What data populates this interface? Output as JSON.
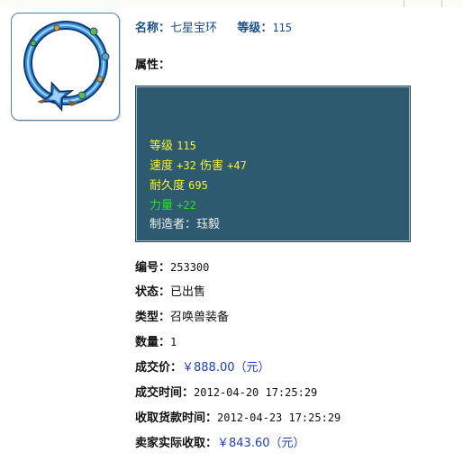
{
  "item": {
    "name_label": "名称：",
    "name": "七星宝环",
    "level_label": "等级：",
    "level": "115"
  },
  "attributes": {
    "label": "属性：",
    "lines": [
      {
        "label": "等级",
        "value": "115",
        "color": "#f7f432"
      },
      {
        "label": "速度",
        "value": "+32",
        "label2": "伤害",
        "value2": "+47",
        "color": "#f7f432"
      },
      {
        "label": "耐久度",
        "value": "695",
        "color": "#f7f432"
      },
      {
        "label": "力量",
        "value": "+22",
        "color": "#28e028"
      },
      {
        "label": "制造者：",
        "value": "珏毅",
        "color": "#f2f2f2"
      }
    ]
  },
  "details": {
    "number_label": "编号：",
    "number": "253300",
    "status_label": "状态：",
    "status": "已出售",
    "type_label": "类型：",
    "type": "召唤兽装备",
    "quantity_label": "数量：",
    "quantity": "1",
    "price_label": "成交价：",
    "price": "￥888.00（元）",
    "deal_time_label": "成交时间：",
    "deal_time": "2012-04-20 17:25:29",
    "payment_time_label": "收取货款时间：",
    "payment_time": "2012-04-23 17:25:29",
    "seller_income_label": "卖家实际收取：",
    "seller_income": "￥843.60（元）"
  },
  "icons": {
    "item_thumbnail": "ring-icon"
  },
  "colors": {
    "title_blue": "#1a4f86",
    "panel_bg": "#2d5a6e",
    "price_blue": "#1f3fb4"
  }
}
